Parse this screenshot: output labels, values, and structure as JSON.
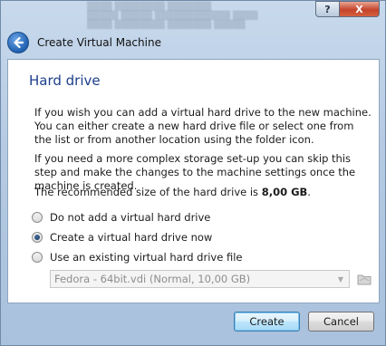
{
  "window": {
    "title": "Create Virtual Machine",
    "help_glyph": "?",
    "close_glyph": "X"
  },
  "section": {
    "title": "Hard drive"
  },
  "text": {
    "para1": "If you wish you can add a virtual hard drive to the new machine. You can either create a new hard drive file or select one from the list or from another location using the folder icon.",
    "para2": "If you need a more complex storage set-up you can skip this step and make the changes to the machine settings once the machine is created.",
    "para3_prefix": "The recommended size of the hard drive is ",
    "para3_size": "8,00 GB",
    "para3_suffix": "."
  },
  "options": [
    {
      "label": "Do not add a virtual hard drive",
      "checked": false
    },
    {
      "label": "Create a virtual hard drive now",
      "checked": true
    },
    {
      "label": "Use an existing virtual hard drive file",
      "checked": false
    }
  ],
  "combo": {
    "value": "Fedora - 64bit.vdi (Normal, 10,00 GB)",
    "enabled": false
  },
  "buttons": {
    "create": "Create",
    "cancel": "Cancel"
  },
  "colors": {
    "title_blue": "#1e3f8c",
    "accent": "#3c7fb1"
  }
}
